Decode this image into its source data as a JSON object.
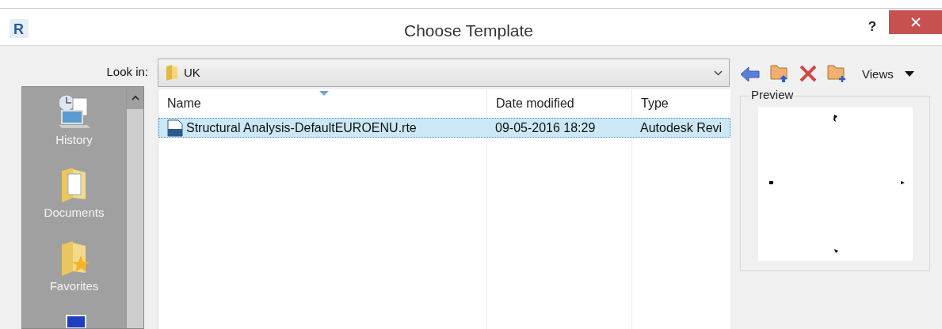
{
  "window": {
    "title": "Choose Template",
    "help": "?",
    "logo": "R"
  },
  "look_in": {
    "label": "Look in:",
    "value": "UK"
  },
  "toolbar": {
    "views": "Views"
  },
  "places": [
    {
      "label": "History",
      "kind": "history"
    },
    {
      "label": "Documents",
      "kind": "documents"
    },
    {
      "label": "Favorites",
      "kind": "favorites"
    }
  ],
  "table": {
    "columns": [
      "Name",
      "Date modified",
      "Type"
    ],
    "rows": [
      {
        "name": "Structural Analysis-DefaultEUROENU.rte",
        "date": "09-05-2016 18:29",
        "type": "Autodesk Revi",
        "selected": true
      }
    ]
  },
  "preview": {
    "label": "Preview"
  }
}
